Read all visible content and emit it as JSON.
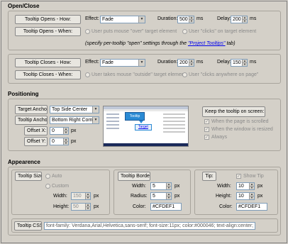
{
  "open_close": {
    "section_title": "Open/Close",
    "opens_how": {
      "button": "Tooltip Opens - How:",
      "effect_label": "Effect:",
      "effect_value": "Fade",
      "duration_label": "Duration:",
      "duration_value": "500",
      "duration_unit": "ms",
      "delay_label": "Delay:",
      "delay_value": "200",
      "delay_unit": "ms"
    },
    "opens_when": {
      "button": "Tooltip Opens - When:",
      "radio1": "User puts mouse \"over\" target element",
      "radio2": "User \"clicks\" on target element"
    },
    "hint_prefix": "(specify per-tooltip \"open\" settings through the ",
    "hint_link": "\"Project Tooltips\"",
    "hint_suffix": " tab)",
    "closes_how": {
      "button": "Tooltip Closes - How:",
      "effect_label": "Effect:",
      "effect_value": "Fade",
      "duration_label": "Duration:",
      "duration_value": "200",
      "duration_unit": "ms",
      "delay_label": "Delay:",
      "delay_value": "150",
      "delay_unit": "ms"
    },
    "closes_when": {
      "button": "Tooltip Closes - When:",
      "radio1": "User takes mouse \"outside\" target element",
      "radio2": "User \"clicks anywhere on page\""
    }
  },
  "positioning": {
    "section_title": "Positioning",
    "target_anchor_button": "Target Anchor:",
    "target_anchor_value": "Top Side Center",
    "tooltip_anchor_button": "Tooltip Anchor:",
    "tooltip_anchor_value": "Bottom Right Corner",
    "offset_x_button": "Offset X:",
    "offset_x_value": "0",
    "offset_y_button": "Offset Y:",
    "offset_y_value": "0",
    "px": "px",
    "preview_tooltip": "Tooltip",
    "preview_target": "Target",
    "keep_button": "Keep the tooltip on screen:",
    "keep_options": [
      "When the page is scrolled",
      "When the window is resized",
      "Always"
    ]
  },
  "appearance": {
    "section_title": "Appearence",
    "size": {
      "button": "Tooltip Size:",
      "auto": "Auto",
      "custom": "Custom",
      "width_label": "Width:",
      "width_value": "150",
      "height_label": "Height:",
      "height_value": "50",
      "unit": "px"
    },
    "border": {
      "button": "Tooltip Border:",
      "width_label": "Width:",
      "width_value": "5",
      "radius_label": "Radius:",
      "radius_value": "5",
      "color_label": "Color:",
      "color_value": "#CFDEF1",
      "unit": "px"
    },
    "tip": {
      "button": "Tip:",
      "show_label": "Show Tip",
      "width_label": "Width:",
      "width_value": "10",
      "height_label": "Height:",
      "height_value": "10",
      "color_label": "Color:",
      "color_value": "#CFDEF1",
      "unit": "px"
    },
    "css_button": "Tooltip CSS:",
    "css_value": "font-family: Verdana,Arial,Helvetica,sans-serif; font-size:11px; color:#000046; text-align:center; backgrc"
  }
}
